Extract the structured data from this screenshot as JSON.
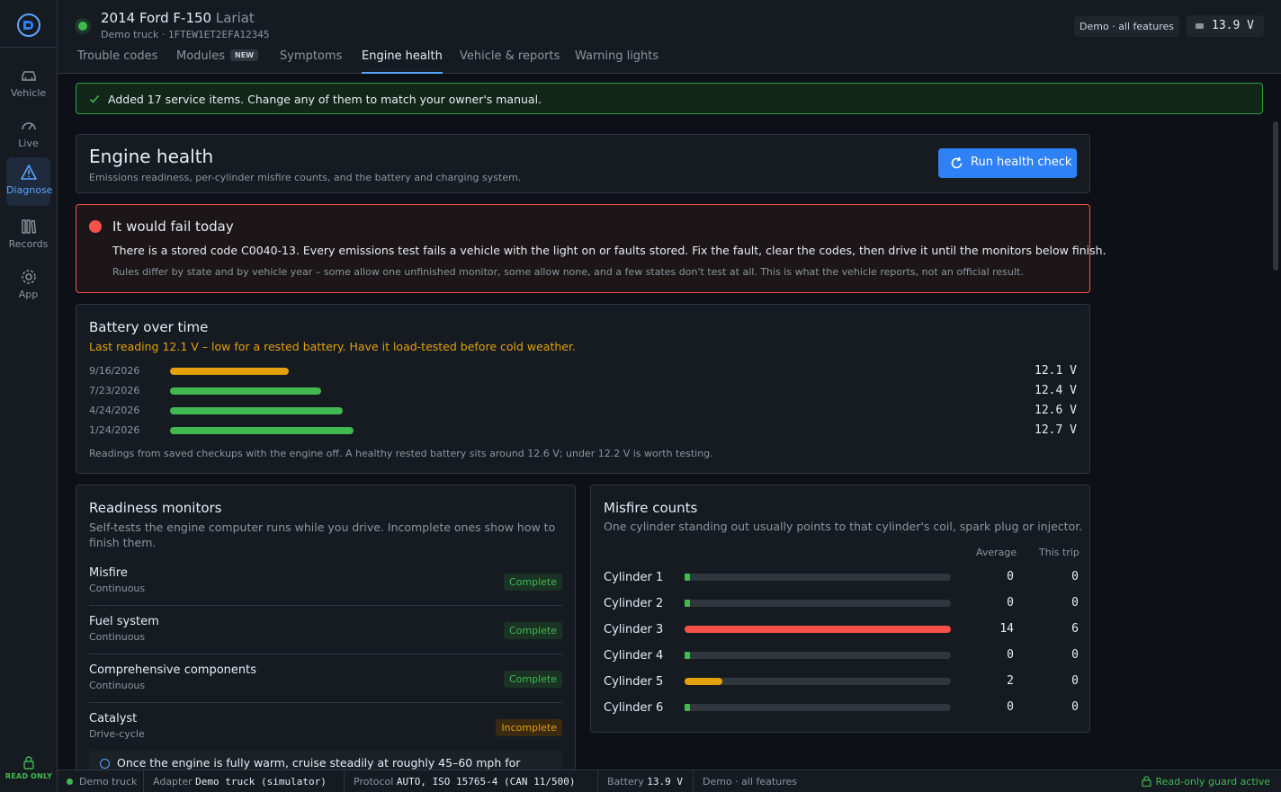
{
  "nav": {
    "items": [
      {
        "label": "Vehicle",
        "icon": "car-icon"
      },
      {
        "label": "Live",
        "icon": "gauge-icon"
      },
      {
        "label": "Diagnose",
        "icon": "warning-triangle-icon",
        "active": true
      },
      {
        "label": "Records",
        "icon": "books-icon"
      },
      {
        "label": "App",
        "icon": "gear-icon"
      }
    ],
    "read_only_label": "READ ONLY"
  },
  "header": {
    "vehicle_name": "2014 Ford F-150",
    "trim": "Lariat",
    "profile": "Demo truck",
    "separator": "·",
    "vin": "1FTEW1ET2EFA12345",
    "demo_pill": "Demo · all features",
    "voltage": "13.9 V"
  },
  "tabs": [
    {
      "label": "Trouble codes"
    },
    {
      "label": "Modules",
      "badge": "NEW"
    },
    {
      "label": "Symptoms"
    },
    {
      "label": "Engine health",
      "active": true
    },
    {
      "label": "Vehicle & reports"
    },
    {
      "label": "Warning lights"
    }
  ],
  "banner": {
    "text": "Added 17 service items. Change any of them to match your owner's manual."
  },
  "engine_health": {
    "title": "Engine health",
    "subtitle": "Emissions readiness, per-cylinder misfire counts, and the battery and charging system.",
    "run_button": "Run health check"
  },
  "verdict": {
    "title": "It would fail today",
    "body": "There is a stored code C0040-13. Every emissions test fails a vehicle with the light on or faults stored. Fix the fault, clear the codes, then drive it until the monitors below finish.",
    "note": "Rules differ by state and by vehicle year – some allow one unfinished monitor, some allow none, and a few states don't test at all. This is what the vehicle reports, not an official result."
  },
  "battery": {
    "title": "Battery over time",
    "warning": "Last reading 12.1 V – low for a rested battery. Have it load-tested before cold weather.",
    "readings": [
      {
        "date": "9/16/2026",
        "value": "12.1 V",
        "volts": 12.1,
        "status": "warn"
      },
      {
        "date": "7/23/2026",
        "value": "12.4 V",
        "volts": 12.4,
        "status": "ok"
      },
      {
        "date": "4/24/2026",
        "value": "12.6 V",
        "volts": 12.6,
        "status": "ok"
      },
      {
        "date": "1/24/2026",
        "value": "12.7 V",
        "volts": 12.7,
        "status": "ok"
      }
    ],
    "footnote": "Readings from saved checkups with the engine off. A healthy rested battery sits around 12.6 V; under 12.2 V is worth testing."
  },
  "readiness": {
    "title": "Readiness monitors",
    "subtitle": "Self-tests the engine computer runs while you drive. Incomplete ones show how to finish them.",
    "monitors": [
      {
        "name": "Misfire",
        "kind": "Continuous",
        "status": "Complete",
        "state": "ok"
      },
      {
        "name": "Fuel system",
        "kind": "Continuous",
        "status": "Complete",
        "state": "ok"
      },
      {
        "name": "Comprehensive components",
        "kind": "Continuous",
        "status": "Complete",
        "state": "ok"
      },
      {
        "name": "Catalyst",
        "kind": "Drive-cycle",
        "status": "Incomplete",
        "state": "warn"
      }
    ],
    "hint": "Once the engine is fully warm, cruise steadily at roughly 45–60 mph for"
  },
  "misfire": {
    "title": "Misfire counts",
    "subtitle": "One cylinder standing out usually points to that cylinder's coil, spark plug or injector.",
    "col_average": "Average",
    "col_trip": "This trip",
    "scale_max": 14,
    "cylinders": [
      {
        "name": "Cylinder 1",
        "average": "0",
        "trip": "0",
        "avg_value": 0,
        "level": "ok"
      },
      {
        "name": "Cylinder 2",
        "average": "0",
        "trip": "0",
        "avg_value": 0,
        "level": "ok"
      },
      {
        "name": "Cylinder 3",
        "average": "14",
        "trip": "6",
        "avg_value": 14,
        "level": "bad"
      },
      {
        "name": "Cylinder 4",
        "average": "0",
        "trip": "0",
        "avg_value": 0,
        "level": "ok"
      },
      {
        "name": "Cylinder 5",
        "average": "2",
        "trip": "0",
        "avg_value": 2,
        "level": "warn"
      },
      {
        "name": "Cylinder 6",
        "average": "0",
        "trip": "0",
        "avg_value": 0,
        "level": "ok"
      }
    ]
  },
  "statusbar": {
    "profile": "Demo truck",
    "adapter_label": "Adapter",
    "adapter_value": "Demo truck (simulator)",
    "protocol_label": "Protocol",
    "protocol_value": "AUTO, ISO 15765-4 (CAN 11/500)",
    "battery_label": "Battery",
    "battery_value": "13.9 V",
    "mode": "Demo · all features",
    "guard": "Read-only guard active"
  },
  "colors": {
    "accent": "#2f81f7",
    "ok": "#3fb950",
    "warn": "#e3a008",
    "bad": "#f85149"
  }
}
